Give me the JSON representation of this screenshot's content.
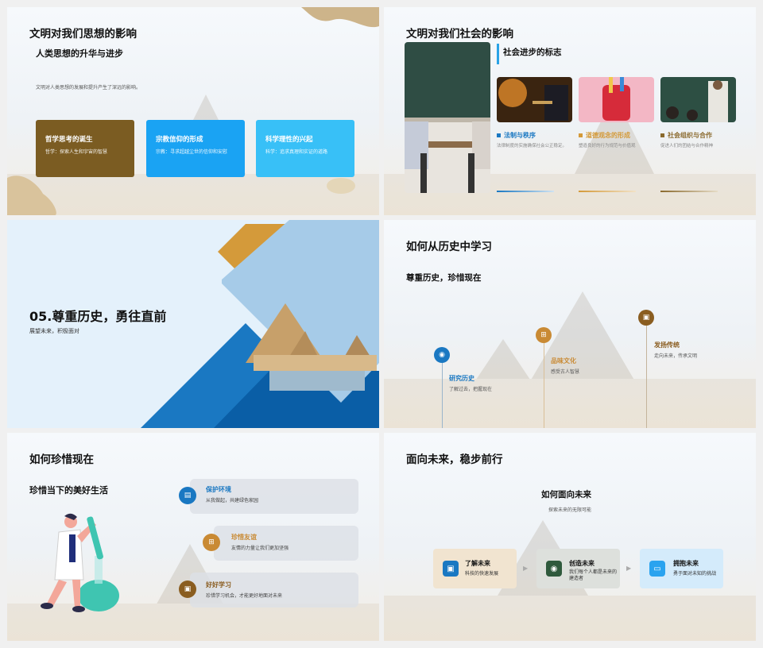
{
  "slide1": {
    "title": "文明对我们思想的影响",
    "subtitle": "人类思想的升华与进步",
    "desc": "文明对人类思想的发展和提升产生了深远的影响。",
    "cards": [
      {
        "title": "哲学思考的诞生",
        "desc": "哲学：探索人生和宇宙的智慧",
        "color": "#7b5c22"
      },
      {
        "title": "宗教信仰的形成",
        "desc": "宗教：寻求超越尘世的信仰和安慰",
        "color": "#1aa3f3"
      },
      {
        "title": "科学理性的兴起",
        "desc": "科学：追求真理和实证的道路",
        "color": "#38c0f7"
      }
    ]
  },
  "slide2": {
    "title": "文明对我们社会的影响",
    "subtitle": "社会进步的标志",
    "items": [
      {
        "label": "法制与秩序",
        "desc": "法律制度的实施确保社会公正稳定。",
        "color": "#1a78c2"
      },
      {
        "label": "道德观念的形成",
        "desc": "塑造良好的行为规范与价值观",
        "color": "#d49a3a"
      },
      {
        "label": "社会组织与合作",
        "desc": "促进人们的团结与合作精神",
        "color": "#8a6a2e"
      }
    ]
  },
  "slide3": {
    "title": "05.尊重历史，勇往直前",
    "subtitle": "展望未来，积极面对"
  },
  "slide4": {
    "title": "如何从历史中学习",
    "subtitle": "尊重历史，珍惜现在",
    "points": [
      {
        "title": "研究历史",
        "desc": "了解过去，把握现在",
        "color": "#1a78c2"
      },
      {
        "title": "品味文化",
        "desc": "感受古人智慧",
        "color": "#c98a34"
      },
      {
        "title": "发扬传统",
        "desc": "走向未来，传承文明",
        "color": "#8a5d20"
      }
    ]
  },
  "slide5": {
    "title": "如何珍惜现在",
    "subtitle": "珍惜当下的美好生活",
    "items": [
      {
        "title": "保护环境",
        "desc": "从我做起，共建绿色家园",
        "color": "#1a78c2",
        "title_color": "#1a78c2"
      },
      {
        "title": "珍惜友谊",
        "desc": "友情的力量让我们更加坚强",
        "color": "#c98a34",
        "title_color": "#c98a34"
      },
      {
        "title": "好好学习",
        "desc": "珍惜学习机会，才能更好地面对未来",
        "color": "#8a5d20",
        "title_color": "#8a5d20"
      }
    ]
  },
  "slide6": {
    "title": "面向未来，稳步前行",
    "center_title": "如何面向未来",
    "center_desc": "探索未来的无限可能",
    "steps": [
      {
        "title": "了解未来",
        "desc": "科技的快速发展",
        "bg": "#f1e4d0",
        "icon": "#1a78c2"
      },
      {
        "title": "创造未来",
        "desc": "我们每个人都是未来的建造者",
        "bg": "#dde0dc",
        "icon": "#2f5a3d"
      },
      {
        "title": "拥抱未来",
        "desc": "勇于面对未知的挑战",
        "bg": "#d4ebfb",
        "icon": "#2aa3ef"
      }
    ]
  }
}
